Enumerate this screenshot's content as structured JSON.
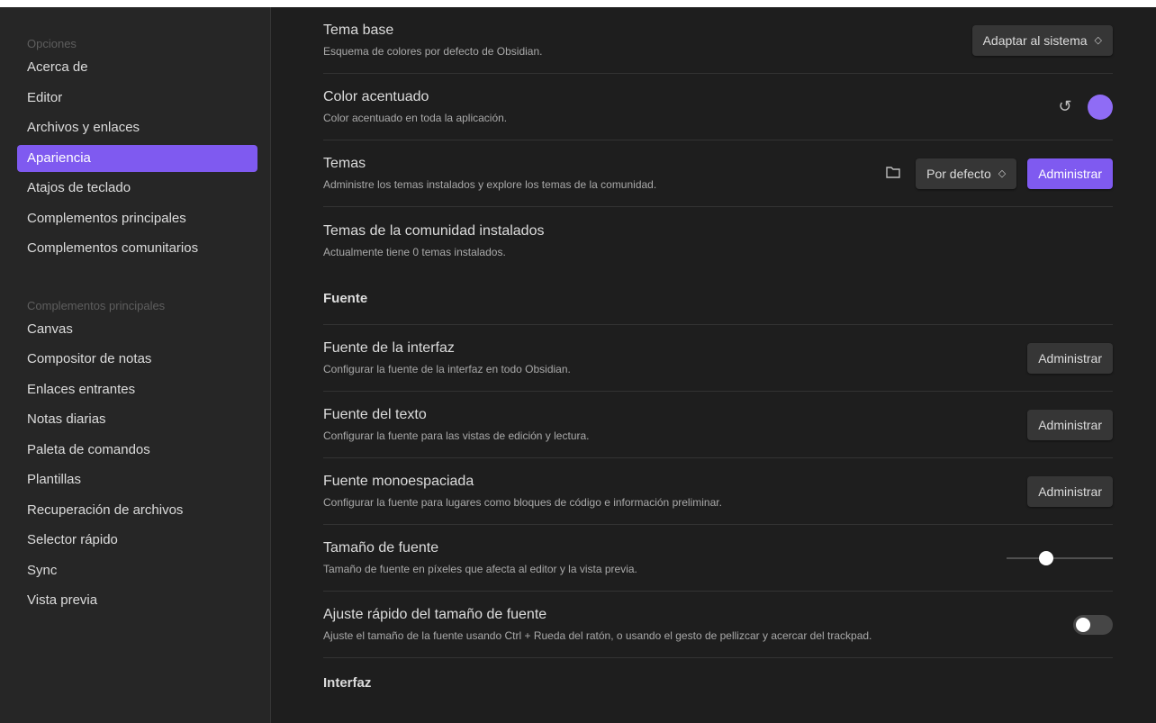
{
  "sidebar": {
    "header_options": "Opciones",
    "options": [
      {
        "label": "Acerca de"
      },
      {
        "label": "Editor"
      },
      {
        "label": "Archivos y enlaces"
      },
      {
        "label": "Apariencia",
        "active": true
      },
      {
        "label": "Atajos de teclado"
      },
      {
        "label": "Complementos principales"
      },
      {
        "label": "Complementos comunitarios"
      }
    ],
    "header_plugins": "Complementos principales",
    "plugins": [
      {
        "label": "Canvas"
      },
      {
        "label": "Compositor de notas"
      },
      {
        "label": "Enlaces entrantes"
      },
      {
        "label": "Notas diarias"
      },
      {
        "label": "Paleta de comandos"
      },
      {
        "label": "Plantillas"
      },
      {
        "label": "Recuperación de archivos"
      },
      {
        "label": "Selector rápido"
      },
      {
        "label": "Sync"
      },
      {
        "label": "Vista previa"
      }
    ]
  },
  "settings": {
    "base_theme": {
      "title": "Tema base",
      "desc": "Esquema de colores por defecto de Obsidian.",
      "value": "Adaptar al sistema"
    },
    "accent": {
      "title": "Color acentuado",
      "desc": "Color acentuado en toda la aplicación.",
      "color": "#8f6cf5"
    },
    "themes": {
      "title": "Temas",
      "desc": "Administre los temas instalados y explore los temas de la comunidad.",
      "value": "Por defecto",
      "button": "Administrar"
    },
    "community": {
      "title": "Temas de la comunidad instalados",
      "desc": "Actualmente tiene 0 temas instalados."
    },
    "section_font": "Fuente",
    "ui_font": {
      "title": "Fuente de la interfaz",
      "desc": "Configurar la fuente de la interfaz en todo Obsidian.",
      "button": "Administrar"
    },
    "text_font": {
      "title": "Fuente del texto",
      "desc": "Configurar la fuente para las vistas de edición y lectura.",
      "button": "Administrar"
    },
    "mono_font": {
      "title": "Fuente monoespaciada",
      "desc": "Configurar la fuente para lugares como bloques de código e información preliminar.",
      "button": "Administrar"
    },
    "font_size": {
      "title": "Tamaño de fuente",
      "desc": "Tamaño de fuente en píxeles que afecta al editor y la vista previa.",
      "slider_fraction": 0.35
    },
    "quick_size": {
      "title": "Ajuste rápido del tamaño de fuente",
      "desc": "Ajuste el tamaño de la fuente usando Ctrl + Rueda del ratón, o usando el gesto de pellizcar y acercar del trackpad.",
      "enabled": false
    },
    "section_interface": "Interfaz"
  },
  "window": {
    "close_label": "✕"
  },
  "colors": {
    "accent": "#7f5af0",
    "background": "#1e1e1e",
    "sidebar": "#262626"
  }
}
